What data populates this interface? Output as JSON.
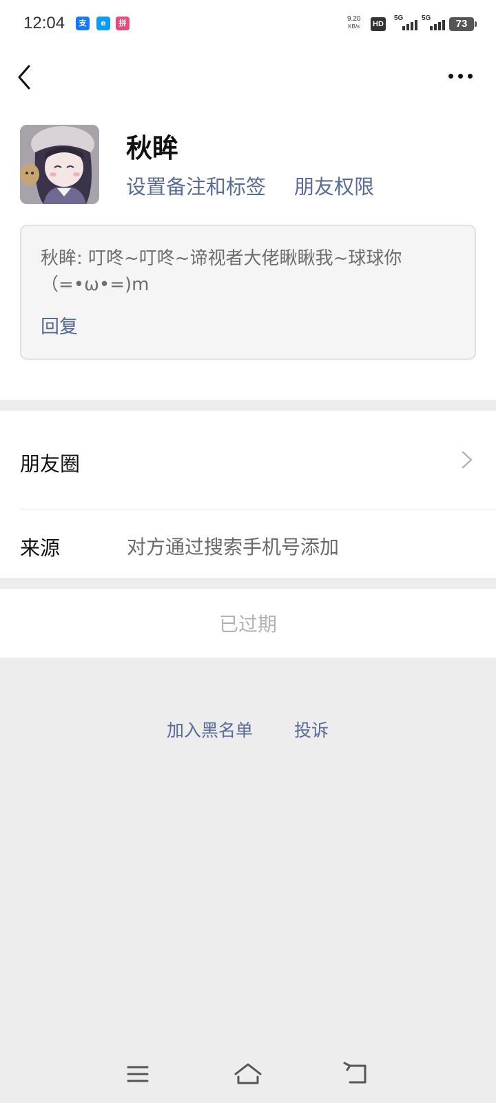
{
  "status_bar": {
    "time": "12:04",
    "net_speed_value": "9.20",
    "net_speed_unit": "KB/s",
    "hd_label": "HD",
    "signal_1_label": "5G",
    "signal_2_label": "5G",
    "battery": "73",
    "app_icons": [
      "alipay-icon",
      "eleme-icon",
      "pinduoduo-icon"
    ]
  },
  "header": {
    "back_icon": "chevron-left-icon",
    "more_icon": "more-dots-icon"
  },
  "profile": {
    "name": "秋眸",
    "remark_link": "设置备注和标签",
    "permission_link": "朋友权限"
  },
  "greeting": {
    "text": "秋眸: 叮咚~叮咚~谛视者大佬瞅瞅我~球球你 （=•ω•=)m",
    "reply": "回复"
  },
  "list": {
    "moments_label": "朋友圈",
    "source_label": "来源",
    "source_value": "对方通过搜索手机号添加"
  },
  "expired": {
    "label": "已过期"
  },
  "footer": {
    "blacklist": "加入黑名单",
    "report": "投诉"
  },
  "colors": {
    "link": "#576b95",
    "background": "#ededed",
    "muted": "#b2b2b2"
  }
}
